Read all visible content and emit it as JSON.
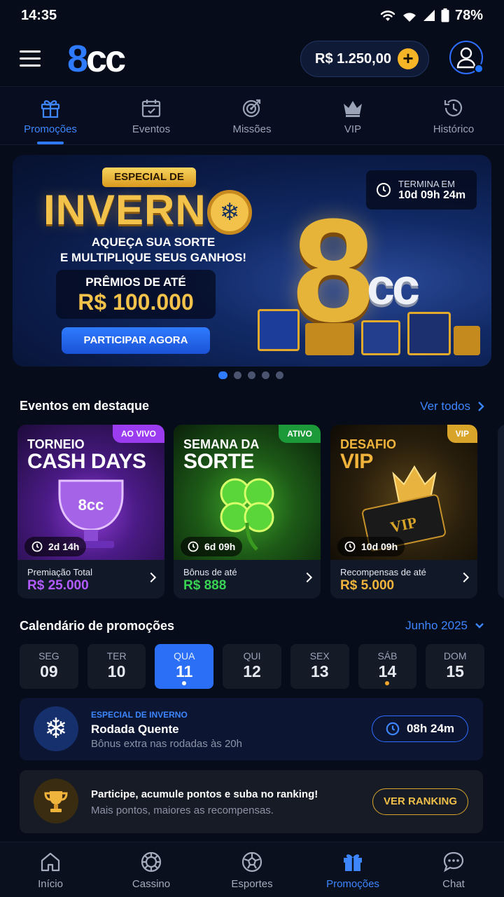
{
  "status": {
    "time": "14:35",
    "battery": "78%"
  },
  "header": {
    "logo_8": "8",
    "logo_cc": "cc",
    "balance": "R$ 1.250,00",
    "add_symbol": "+"
  },
  "tabs": [
    {
      "label": "Promoções",
      "icon": "gift-icon",
      "active": true
    },
    {
      "label": "Eventos",
      "icon": "calendar-icon"
    },
    {
      "label": "Missões",
      "icon": "target-icon"
    },
    {
      "label": "VIP",
      "icon": "crown-icon"
    },
    {
      "label": "Histórico",
      "icon": "history-icon"
    }
  ],
  "banner": {
    "badge": "ESPECIAL DE",
    "title": "INVERN",
    "subtitle_1": "AQUEÇA SUA SORTE",
    "subtitle_2": "E MULTIPLIQUE SEUS GANHOS!",
    "prize_label": "PRÊMIOS DE ATÉ",
    "prize_value": "R$ 100.000",
    "cta": "PARTICIPAR AGORA",
    "timer_label": "TERMINA EM",
    "timer_value": "10d 09h 24m",
    "art_8": "8",
    "art_cc": "cc",
    "slides": 5,
    "active_slide": 1
  },
  "featured": {
    "title": "Eventos em destaque",
    "see_all": "Ver todos",
    "events": [
      {
        "tag": "AO VIVO",
        "tag_color": "#9b3cf0",
        "kicker": "TORNEIO",
        "name": "CASH DAYS",
        "timer": "2d 14h",
        "foot_label": "Premiação Total",
        "foot_value": "R$ 25.000",
        "value_color": "#b25cff"
      },
      {
        "tag": "ATIVO",
        "tag_color": "#1c9a3a",
        "kicker": "SEMANA DA",
        "name": "SORTE",
        "timer": "6d 09h",
        "foot_label": "Bônus de até",
        "foot_value": "R$ 888",
        "value_color": "#39d353"
      },
      {
        "tag": "VIP",
        "tag_color": "#d9a42a",
        "kicker": "DESAFIO",
        "name": "VIP",
        "timer": "10d 09h",
        "foot_label": "Recompensas de até",
        "foot_value": "R$ 5.000",
        "value_color": "#f0b43c"
      }
    ]
  },
  "calendar": {
    "title": "Calendário de promoções",
    "month": "Junho 2025",
    "days": [
      {
        "name": "SEG",
        "num": "09"
      },
      {
        "name": "TER",
        "num": "10"
      },
      {
        "name": "QUA",
        "num": "11",
        "active": true,
        "dot": "#ffffff"
      },
      {
        "name": "QUI",
        "num": "12"
      },
      {
        "name": "SEX",
        "num": "13"
      },
      {
        "name": "SÁB",
        "num": "14",
        "dot": "#f0a72a"
      },
      {
        "name": "DOM",
        "num": "15"
      }
    ]
  },
  "promo": {
    "kicker": "ESPECIAL DE INVERNO",
    "title": "Rodada Quente",
    "desc": "Bônus extra nas rodadas às 20h",
    "timer": "08h 24m"
  },
  "ranking": {
    "title": "Participe, acumule pontos e suba no ranking!",
    "desc": "Mais pontos, maiores as recompensas.",
    "button": "VER RANKING"
  },
  "bottom_nav": [
    {
      "label": "Início",
      "icon": "home-icon"
    },
    {
      "label": "Cassino",
      "icon": "chip-icon"
    },
    {
      "label": "Esportes",
      "icon": "ball-icon"
    },
    {
      "label": "Promoções",
      "icon": "gift-icon",
      "active": true
    },
    {
      "label": "Chat",
      "icon": "chat-icon"
    }
  ]
}
